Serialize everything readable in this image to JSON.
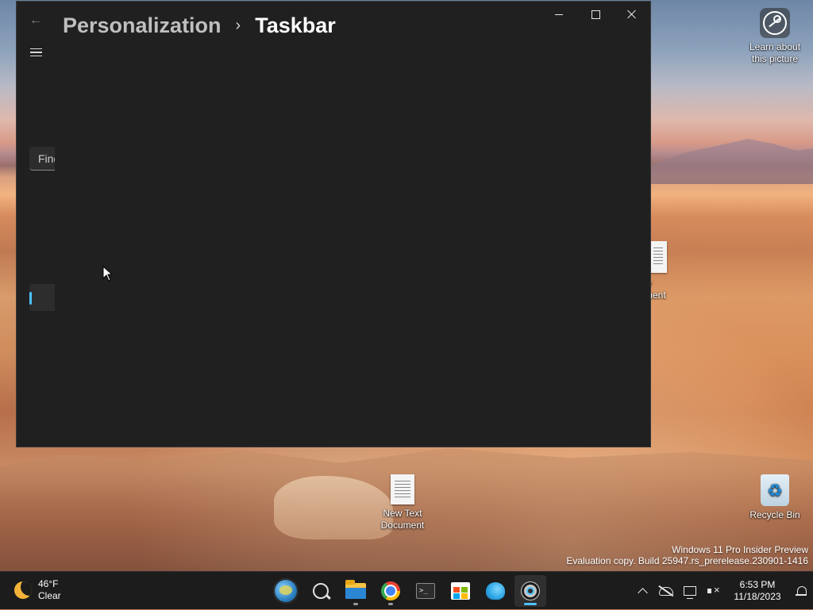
{
  "window": {
    "breadcrumb_parent": "Personalization",
    "breadcrumb_separator": "›",
    "breadcrumb_current": "Taskbar",
    "search_placeholder_visible": "Find"
  },
  "desktop": {
    "icons": [
      {
        "label_line1": "Learn about",
        "label_line2": "this picture"
      },
      {
        "label_line1": "New Text",
        "label_line2": "Document"
      },
      {
        "label_line1": "Recycle Bin"
      },
      {
        "label_line1": "w",
        "label_line2": "ment"
      }
    ],
    "watermark_line1": "Windows 11 Pro Insider Preview",
    "watermark_line2": "Evaluation copy. Build 25947.rs_prerelease.230901-1416"
  },
  "taskbar": {
    "weather_temp": "46°F",
    "weather_condition": "Clear",
    "time": "6:53 PM",
    "date": "11/18/2023",
    "apps": [
      "globe-app",
      "search",
      "file-explorer",
      "chrome",
      "terminal",
      "microsoft-store",
      "edge-like-app",
      "settings"
    ],
    "active_app": "settings"
  },
  "colors": {
    "accent": "#4cc2ff",
    "window_bg": "#202020",
    "taskbar_bg": "#1c1c1c"
  }
}
